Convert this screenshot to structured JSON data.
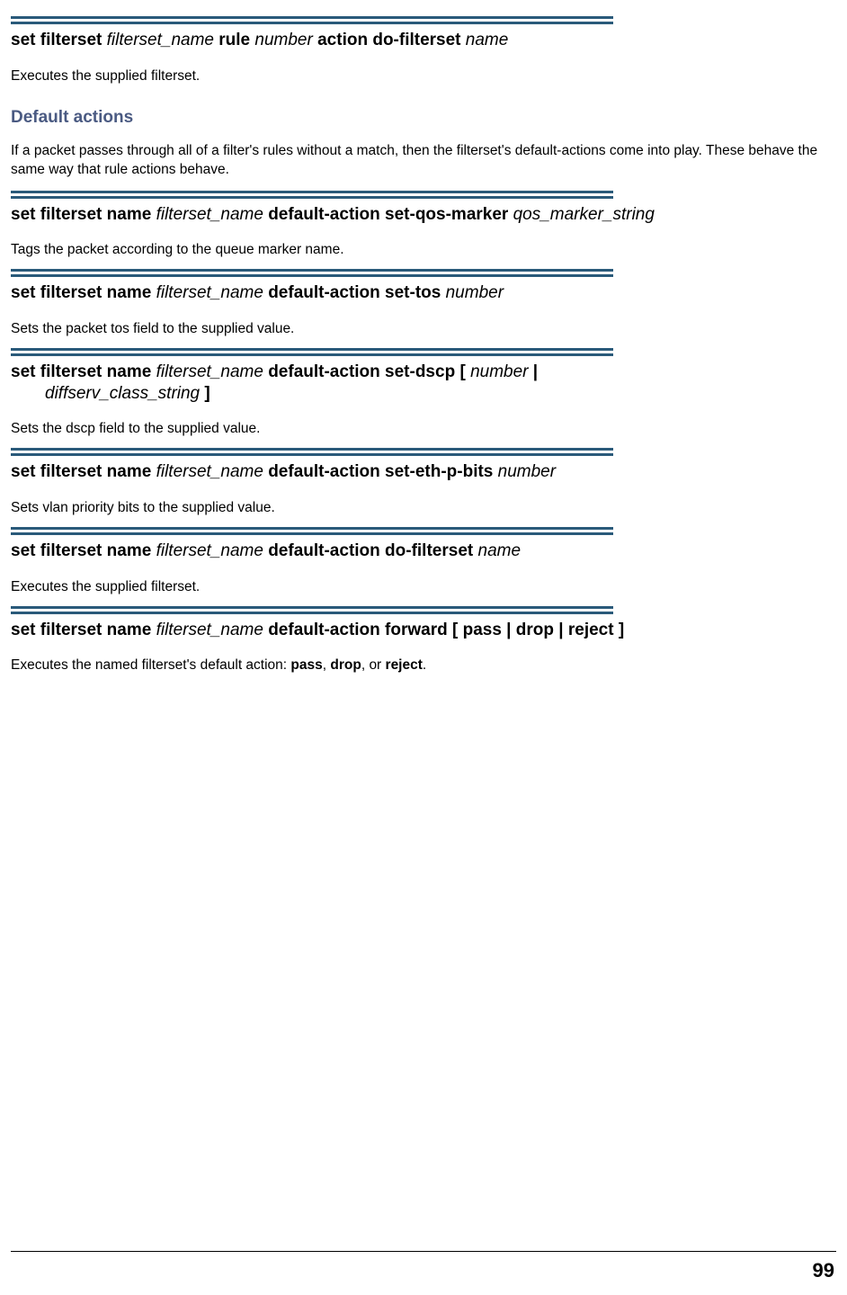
{
  "commands": [
    {
      "title_parts": [
        {
          "text": "set filterset ",
          "style": "bold"
        },
        {
          "text": "filterset_name",
          "style": "italic"
        },
        {
          "text": " rule ",
          "style": "bold"
        },
        {
          "text": "number",
          "style": "italic"
        },
        {
          "text": " action do-filterset ",
          "style": "bold"
        },
        {
          "text": "name",
          "style": "italic"
        }
      ],
      "desc": "Executes the supplied filterset."
    }
  ],
  "section_heading": "Default actions",
  "section_intro": "If a packet passes through all of a filter's rules without a match, then the filterset's default-actions come into play. These behave the same way that rule actions behave.",
  "default_commands": [
    {
      "title_parts": [
        {
          "text": "set filterset name ",
          "style": "bold"
        },
        {
          "text": "filterset_name",
          "style": "italic"
        },
        {
          "text": " default-action set-qos-marker ",
          "style": "bold"
        },
        {
          "text": "qos_marker_string",
          "style": "italic"
        }
      ],
      "desc": "Tags the packet according to the queue marker name."
    },
    {
      "title_parts": [
        {
          "text": "set filterset name ",
          "style": "bold"
        },
        {
          "text": "filterset_name",
          "style": "italic"
        },
        {
          "text": " default-action set-tos ",
          "style": "bold"
        },
        {
          "text": "number",
          "style": "italic"
        }
      ],
      "desc": "Sets the packet tos field to the supplied value."
    },
    {
      "title_parts": [
        {
          "text": "set filterset name ",
          "style": "bold"
        },
        {
          "text": "filterset_name",
          "style": "italic"
        },
        {
          "text": " default-action set-dscp [ ",
          "style": "bold"
        },
        {
          "text": "number",
          "style": "italic"
        },
        {
          "text": " | ",
          "style": "bold"
        },
        {
          "text": "diffserv_class_string",
          "style": "italic",
          "newline_indent": true
        },
        {
          "text": " ]",
          "style": "bold"
        }
      ],
      "desc": "Sets the dscp field to the supplied value."
    },
    {
      "title_parts": [
        {
          "text": "set filterset name ",
          "style": "bold"
        },
        {
          "text": "filterset_name",
          "style": "italic"
        },
        {
          "text": " default-action set-eth-p-bits ",
          "style": "bold"
        },
        {
          "text": "number",
          "style": "italic"
        }
      ],
      "desc": "Sets vlan priority bits to the supplied value."
    },
    {
      "title_parts": [
        {
          "text": "set filterset name ",
          "style": "bold"
        },
        {
          "text": "filterset_name",
          "style": "italic"
        },
        {
          "text": " default-action do-filterset ",
          "style": "bold"
        },
        {
          "text": "name",
          "style": "italic"
        }
      ],
      "desc": "Executes the supplied filterset."
    },
    {
      "title_parts": [
        {
          "text": "set filterset name ",
          "style": "bold"
        },
        {
          "text": "filterset_name",
          "style": "italic"
        },
        {
          "text": " default-action forward  [ pass | drop | reject ]",
          "style": "bold"
        }
      ],
      "desc_parts": [
        {
          "text": "Executes the named filterset's default action: ",
          "style": "normal"
        },
        {
          "text": "pass",
          "style": "bold"
        },
        {
          "text": ", ",
          "style": "normal"
        },
        {
          "text": "drop",
          "style": "bold"
        },
        {
          "text": ", or ",
          "style": "normal"
        },
        {
          "text": "reject",
          "style": "bold"
        },
        {
          "text": ".",
          "style": "normal"
        }
      ]
    }
  ],
  "page_number": "99"
}
